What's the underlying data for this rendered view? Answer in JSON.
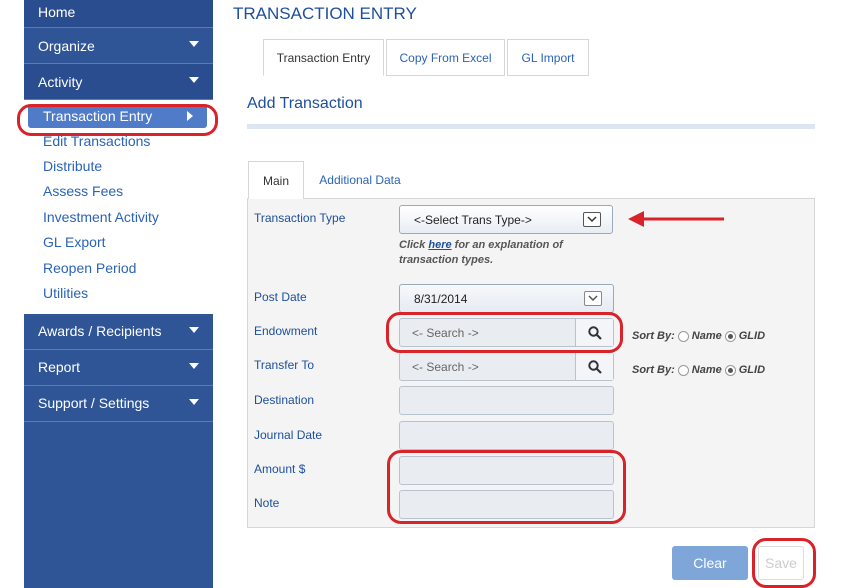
{
  "sidebar": {
    "home": "Home",
    "organize": "Organize",
    "activity": "Activity",
    "activity_items": [
      "Transaction Entry",
      "Edit Transactions",
      "Distribute",
      "Assess Fees",
      "Investment Activity",
      "GL Export",
      "Reopen Period",
      "Utilities"
    ],
    "awards": "Awards / Recipients",
    "report": "Report",
    "support": "Support / Settings"
  },
  "page": {
    "title": "TRANSACTION ENTRY"
  },
  "tabs": [
    "Transaction Entry",
    "Copy From Excel",
    "GL Import"
  ],
  "section_title": "Add Transaction",
  "inner_tabs": [
    "Main",
    "Additional Data"
  ],
  "form": {
    "transaction_type_label": "Transaction Type",
    "transaction_type_value": "<-Select Trans Type->",
    "hint_pre": "Click ",
    "hint_link": "here",
    "hint_post": " for an explanation of transaction types.",
    "post_date_label": "Post Date",
    "post_date_value": "8/31/2014",
    "endowment_label": "Endowment",
    "endowment_placeholder": "<- Search ->",
    "transfer_to_label": "Transfer To",
    "transfer_to_placeholder": "<- Search ->",
    "sort_by": "Sort By:",
    "sort_name": "Name",
    "sort_glid": "GLID",
    "destination_label": "Destination",
    "journal_date_label": "Journal Date",
    "amount_label": "Amount $",
    "note_label": "Note"
  },
  "buttons": {
    "clear": "Clear",
    "save": "Save"
  },
  "colors": {
    "sidebar": "#2f5597",
    "accent": "#1d4f9c",
    "highlight": "#d9232a"
  }
}
